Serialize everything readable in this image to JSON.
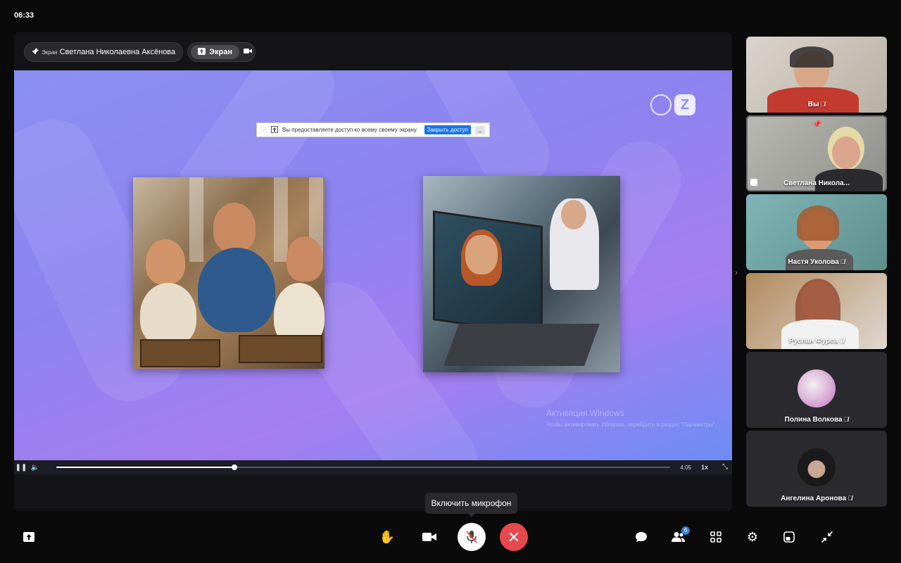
{
  "clock": "06:33",
  "stage": {
    "presenter_pill": {
      "small_label": "Экран",
      "name": "Светлана Николаевна Аксёнова"
    },
    "screen_pill_label": "Экран"
  },
  "share_bar": {
    "message": "Вы предоставляете доступ ко всему своему экрану.",
    "stop_button": "Закрыть доступ",
    "minimize": "_"
  },
  "watermark": {
    "title": "Активация Windows",
    "subtitle": "Чтобы активировать Windows, перейдите в раздел \"Параметры\"."
  },
  "player": {
    "time": "4:05",
    "speed": "1x",
    "progress_fraction": 0.29
  },
  "tooltip": "Включить микрофон",
  "participants": [
    {
      "name": "Вы",
      "muted": true
    },
    {
      "name": "Светлана Никола...",
      "muted": false,
      "pinned": true,
      "sharing": true
    },
    {
      "name": "Настя Уколова",
      "muted": true
    },
    {
      "name": "Руслан Фурса",
      "muted": true
    },
    {
      "name": "Полина Волкова",
      "muted": true
    },
    {
      "name": "Ангелина Аронова",
      "muted": true
    }
  ],
  "toolbar": {
    "participants_count": "6"
  },
  "colors": {
    "slide_accent": "#8a90f2",
    "end_call": "#e5484d",
    "badge": "#3a7bd5"
  }
}
